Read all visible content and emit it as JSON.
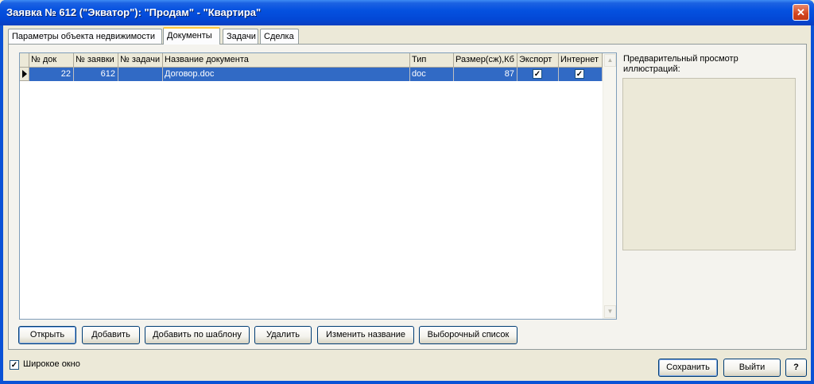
{
  "window": {
    "title": "Заявка № 612 (\"Экватор\"): \"Продам\" - \"Квартира\"",
    "close_glyph": "✕"
  },
  "tabs": [
    {
      "label": "Параметры объекта недвижимости"
    },
    {
      "label": "Документы"
    },
    {
      "label": "Задачи"
    },
    {
      "label": "Сделка"
    }
  ],
  "grid": {
    "columns": [
      "№ док",
      "№ заявки",
      "№ задачи",
      "Название документа",
      "Тип",
      "Размер(сж),Кб",
      "Экспорт",
      "Интернет"
    ],
    "rows": [
      {
        "doc_no": "22",
        "request_no": "612",
        "task_no": "",
        "name": "Договор.doc",
        "type": "doc",
        "size": "87",
        "export_check": "✓",
        "internet_check": "✓"
      }
    ]
  },
  "preview": {
    "label_line1": "Предварительный просмотр",
    "label_line2": "иллюстраций:"
  },
  "buttons": {
    "open": "Открыть",
    "add": "Добавить",
    "add_template": "Добавить по шаблону",
    "delete": "Удалить",
    "rename": "Изменить название",
    "select_list": "Выборочный список",
    "save": "Сохранить",
    "exit": "Выйти",
    "help": "?"
  },
  "wide_window": {
    "label": "Широкое окно",
    "check": "✓"
  },
  "icons": {
    "scroll_up": "▲",
    "scroll_down": "▼"
  }
}
